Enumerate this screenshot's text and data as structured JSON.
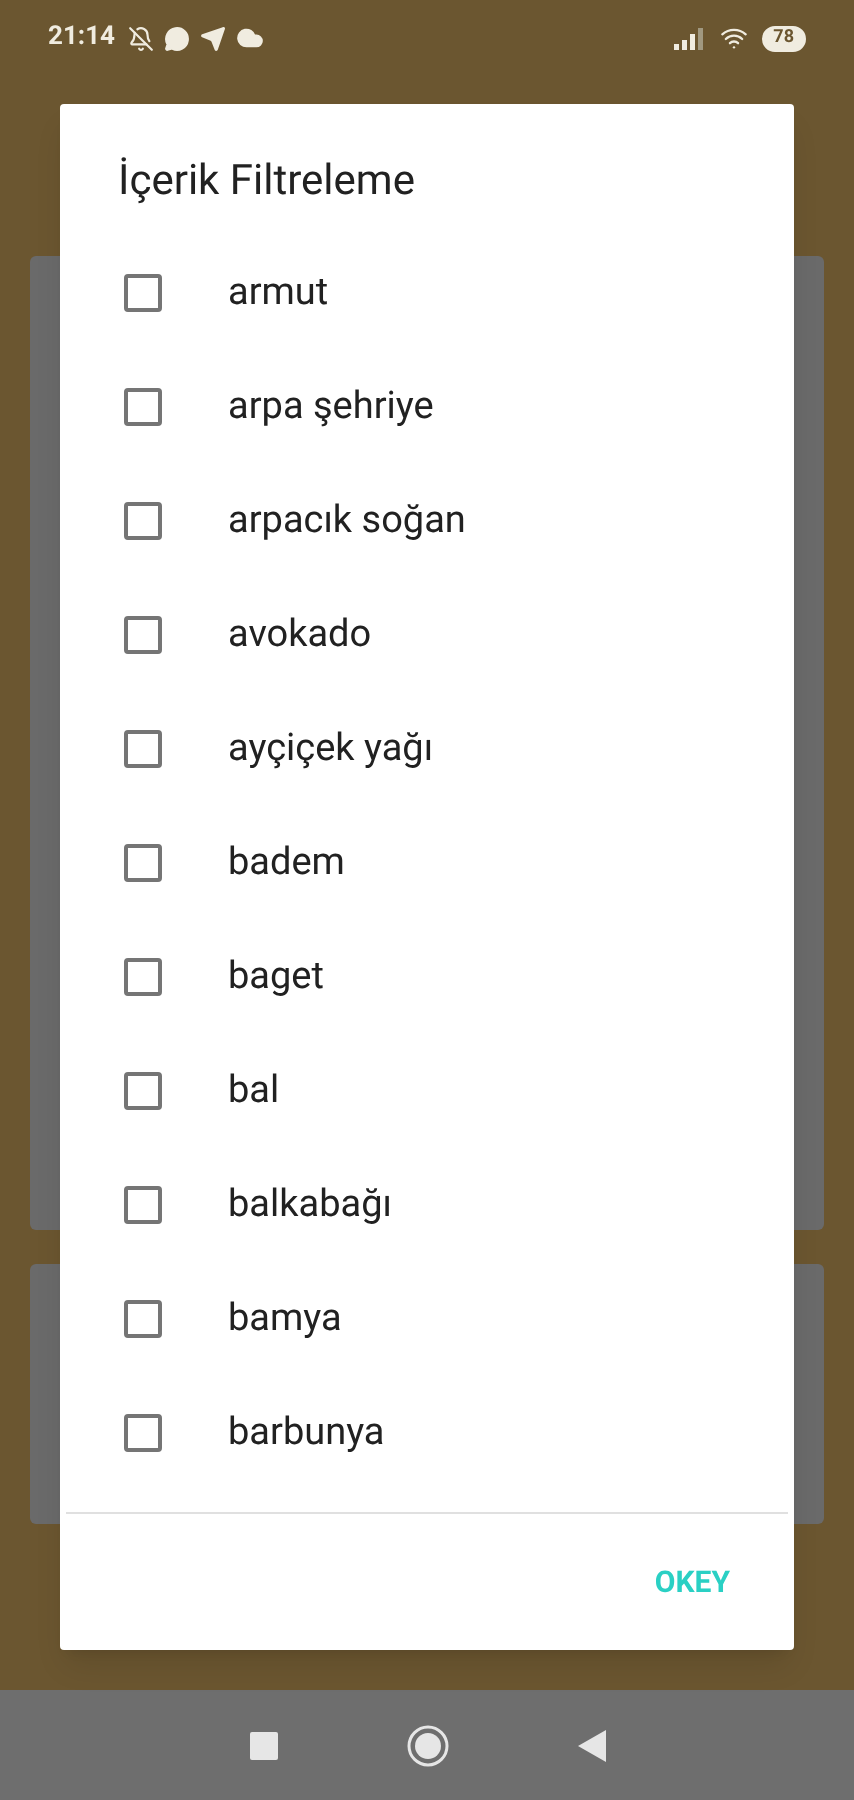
{
  "status_bar": {
    "time": "21:14",
    "battery": "78"
  },
  "dialog": {
    "title": "İçerik Filtreleme",
    "items": [
      {
        "label": "armut",
        "checked": false
      },
      {
        "label": "arpa şehriye",
        "checked": false
      },
      {
        "label": "arpacık soğan",
        "checked": false
      },
      {
        "label": "avokado",
        "checked": false
      },
      {
        "label": "ayçiçek yağı",
        "checked": false
      },
      {
        "label": "badem",
        "checked": false
      },
      {
        "label": "baget",
        "checked": false
      },
      {
        "label": "bal",
        "checked": false
      },
      {
        "label": "balkabağı",
        "checked": false
      },
      {
        "label": "bamya",
        "checked": false
      },
      {
        "label": "barbunya",
        "checked": false
      }
    ],
    "button": "OKEY"
  }
}
